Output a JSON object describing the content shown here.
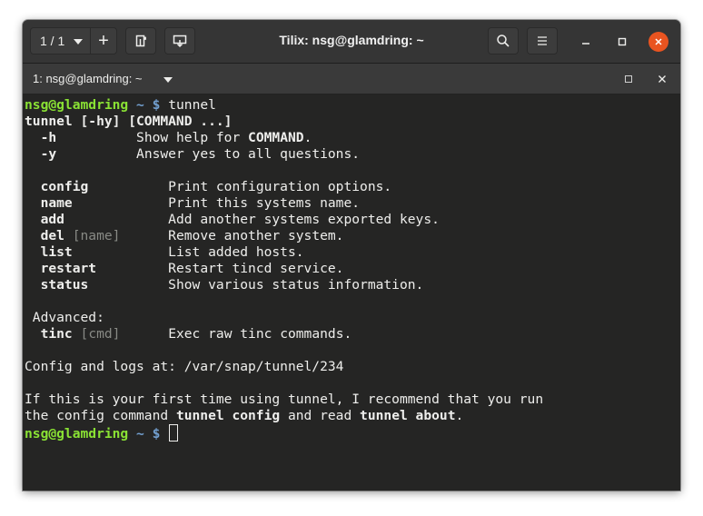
{
  "window": {
    "title": "Tilix: nsg@glamdring: ~",
    "session_label": "1 / 1",
    "add_label": "+"
  },
  "tab": {
    "title": "1: nsg@glamdring: ~"
  },
  "terminal": {
    "prompt_user": "nsg@glamdring",
    "prompt_path": "~",
    "prompt_symbol": "$",
    "command": "tunnel",
    "usage": "tunnel [-hy] [COMMAND ...]",
    "options": [
      {
        "flag": "-h",
        "desc_pre": "Show help for ",
        "desc_bold": "COMMAND",
        "desc_post": "."
      },
      {
        "flag": "-y",
        "desc_pre": "Answer yes to all questions.",
        "desc_bold": "",
        "desc_post": ""
      }
    ],
    "commands": [
      {
        "name": "config",
        "arg": "",
        "desc": "Print configuration options."
      },
      {
        "name": "name",
        "arg": "",
        "desc": "Print this systems name."
      },
      {
        "name": "add",
        "arg": "",
        "desc": "Add another systems exported keys."
      },
      {
        "name": "del",
        "arg": "[name]",
        "desc": "Remove another system."
      },
      {
        "name": "list",
        "arg": "",
        "desc": "List added hosts."
      },
      {
        "name": "restart",
        "arg": "",
        "desc": "Restart tincd service."
      },
      {
        "name": "status",
        "arg": "",
        "desc": "Show various status information."
      }
    ],
    "advanced_label": "Advanced:",
    "advanced": [
      {
        "name": "tinc",
        "arg": "[cmd]",
        "desc": "Exec raw tinc commands."
      }
    ],
    "config_logs": "Config and logs at: /var/snap/tunnel/234",
    "first_time_1": "If this is your first time using tunnel, I recommend that you run",
    "first_time_2_pre": "the config command ",
    "first_time_2_b1": "tunnel config",
    "first_time_2_mid": " and read ",
    "first_time_2_b2": "tunnel about",
    "first_time_2_post": "."
  }
}
